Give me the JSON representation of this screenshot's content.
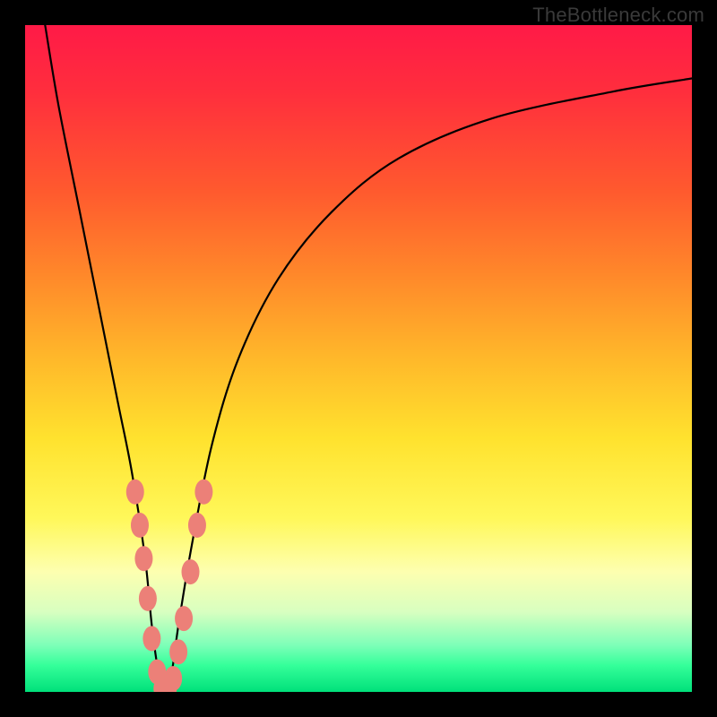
{
  "watermark": "TheBottleneck.com",
  "chart_data": {
    "type": "line",
    "title": "",
    "xlabel": "",
    "ylabel": "",
    "xlim": [
      0,
      100
    ],
    "ylim": [
      0,
      100
    ],
    "series": [
      {
        "name": "bottleneck-curve",
        "x": [
          3,
          5,
          8,
          10,
          12,
          14,
          16,
          18,
          19,
          20,
          21,
          22,
          23,
          25,
          28,
          32,
          38,
          46,
          56,
          70,
          88,
          100
        ],
        "y": [
          100,
          88,
          73,
          63,
          53,
          43,
          33,
          20,
          10,
          3,
          0,
          3,
          10,
          22,
          37,
          50,
          62,
          72,
          80,
          86,
          90,
          92
        ]
      }
    ],
    "markers": {
      "name": "highlighted-points",
      "color": "#ec8078",
      "points": [
        {
          "x": 16.5,
          "y": 30
        },
        {
          "x": 17.2,
          "y": 25
        },
        {
          "x": 17.8,
          "y": 20
        },
        {
          "x": 18.4,
          "y": 14
        },
        {
          "x": 19.0,
          "y": 8
        },
        {
          "x": 19.8,
          "y": 3
        },
        {
          "x": 20.6,
          "y": 0.5
        },
        {
          "x": 21.4,
          "y": 0.5
        },
        {
          "x": 22.2,
          "y": 2
        },
        {
          "x": 23.0,
          "y": 6
        },
        {
          "x": 23.8,
          "y": 11
        },
        {
          "x": 24.8,
          "y": 18
        },
        {
          "x": 25.8,
          "y": 25
        },
        {
          "x": 26.8,
          "y": 30
        }
      ]
    },
    "gradient_stops": [
      {
        "pos": 0,
        "color": "#ff1a47"
      },
      {
        "pos": 25,
        "color": "#ff5a2e"
      },
      {
        "pos": 50,
        "color": "#ffb82a"
      },
      {
        "pos": 74,
        "color": "#fff85a"
      },
      {
        "pos": 88,
        "color": "#d8ffc0"
      },
      {
        "pos": 100,
        "color": "#00e07a"
      }
    ]
  }
}
